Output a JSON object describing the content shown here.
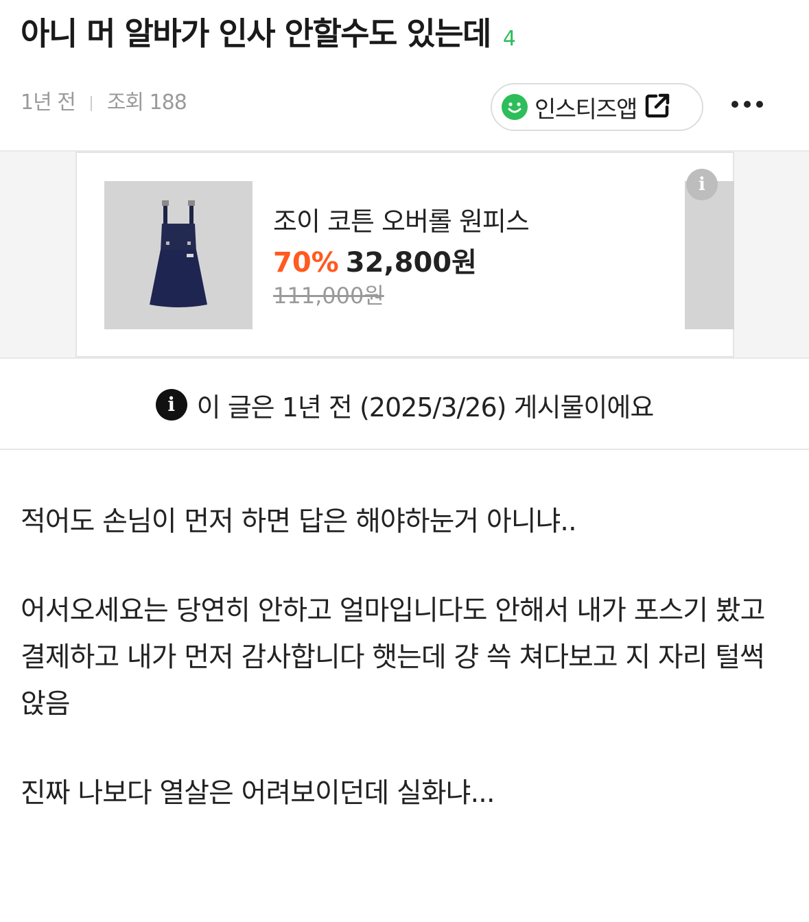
{
  "post": {
    "title": "아니 머 알바가 인사 안할수도 있는데",
    "comment_count": "4",
    "time_ago": "1년 전",
    "views": "조회 188"
  },
  "header": {
    "app_button_label": "인스티즈앱",
    "smiley_icon": "smiley-icon",
    "external_icon": "external-link-icon",
    "more_icon": "more-dots-icon"
  },
  "ad": {
    "product_name": "조이 코튼 오버롤 원피스",
    "discount": "70%",
    "price": "32,800원",
    "original_price": "111,000원",
    "info_icon": "info-icon"
  },
  "notice": {
    "text": "이 글은 1년 전 (2025/3/26) 게시물이에요"
  },
  "body": {
    "paragraphs": [
      "적어도 손님이 먼저 하면 답은 해야하눈거 아니냐..",
      "어서오세요는 당연히 안하고 얼마입니다도 안해서 내가 포스기 봤고 결제하고 내가 먼저 감사합니다 햇는데 걍 쓱 쳐다보고 지 자리 털썩 앉음",
      "진짜 나보다 열살은 어려보이던데 실화냐..."
    ]
  },
  "colors": {
    "accent_green": "#2dbd5a",
    "discount_orange": "#ff5a1f"
  }
}
